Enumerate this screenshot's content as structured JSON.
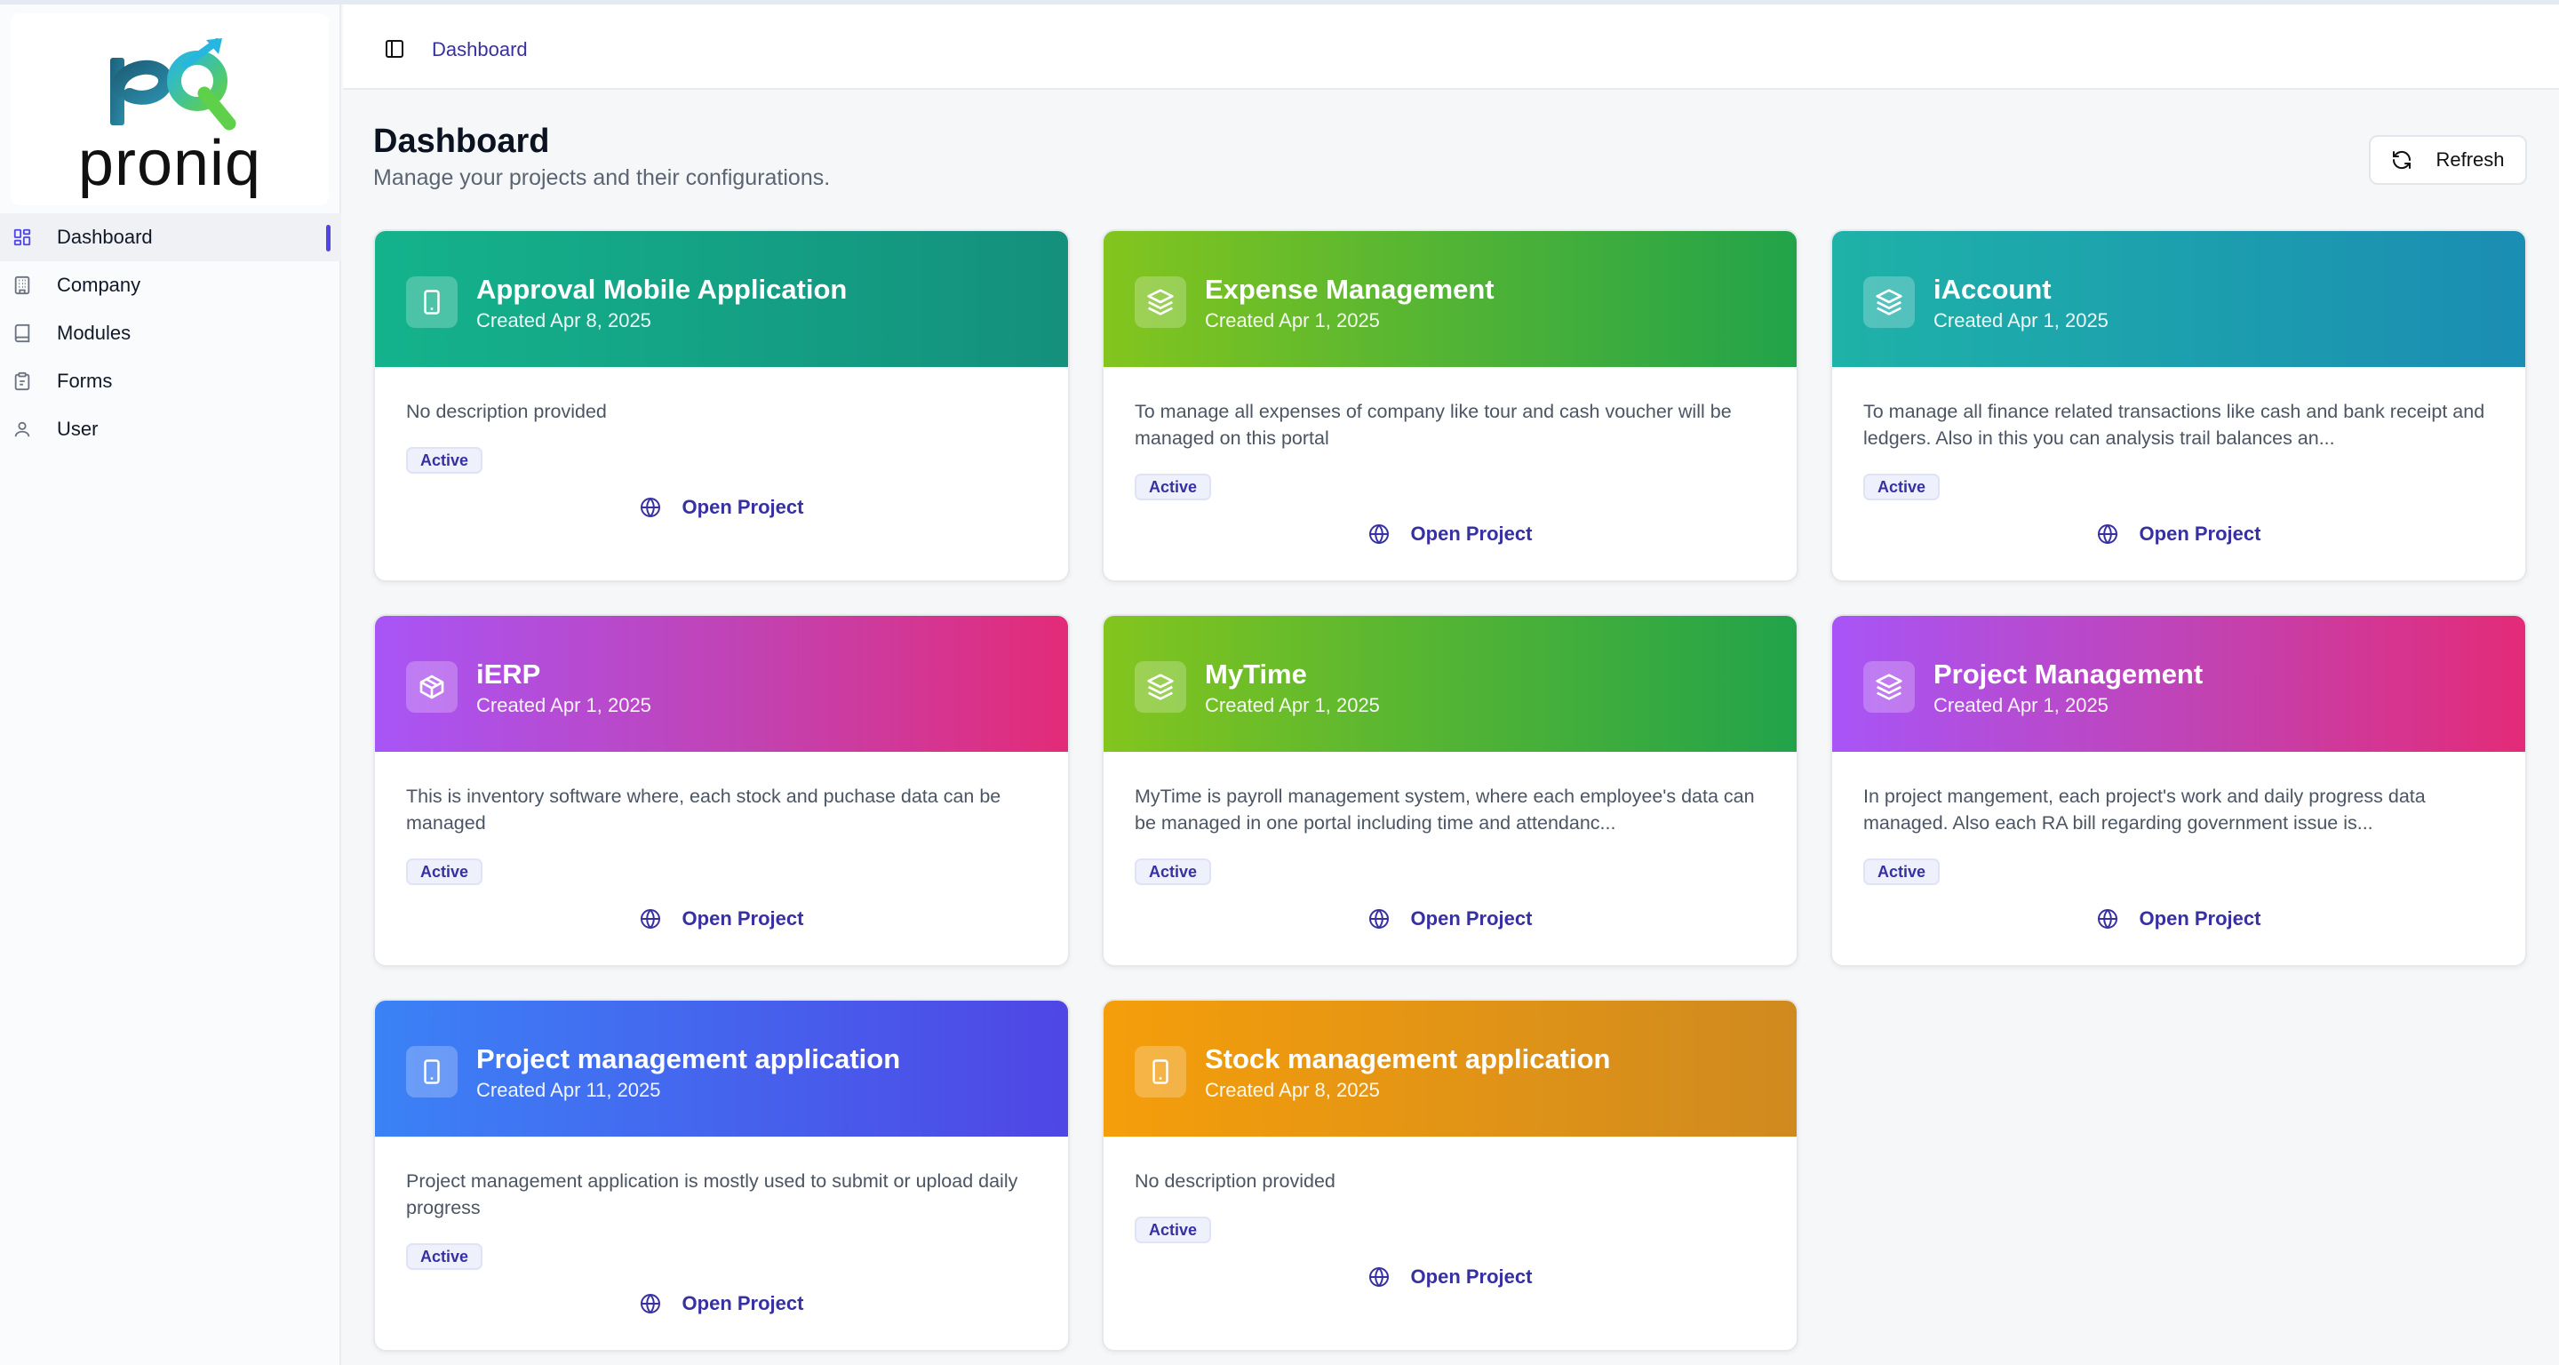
{
  "brand": {
    "name": "proniq"
  },
  "sidebar": {
    "items": [
      {
        "label": "Dashboard",
        "icon": "grid-icon",
        "active": true
      },
      {
        "label": "Company",
        "icon": "building-icon"
      },
      {
        "label": "Modules",
        "icon": "book-icon"
      },
      {
        "label": "Forms",
        "icon": "clipboard-icon"
      },
      {
        "label": "User",
        "icon": "user-icon"
      }
    ]
  },
  "header": {
    "breadcrumb": "Dashboard"
  },
  "page": {
    "title": "Dashboard",
    "subtitle": "Manage your projects and their configurations.",
    "refresh_label": "Refresh"
  },
  "projects": [
    {
      "title": "Approval Mobile Application",
      "created": "Created Apr 8, 2025",
      "description": "No description provided",
      "status": "Active",
      "action": "Open Project",
      "icon": "smartphone-icon",
      "gradient": "teal"
    },
    {
      "title": "Expense Management",
      "created": "Created Apr 1, 2025",
      "description": "To manage all expenses of company like tour and cash voucher will be managed on this portal",
      "status": "Active",
      "action": "Open Project",
      "icon": "layers-icon",
      "gradient": "green"
    },
    {
      "title": "iAccount",
      "created": "Created Apr 1, 2025",
      "description": "To manage all finance related transactions like cash and bank receipt and ledgers. Also in this you can analysis trail balances an...",
      "status": "Active",
      "action": "Open Project",
      "icon": "layers-icon",
      "gradient": "cyan"
    },
    {
      "title": "iERP",
      "created": "Created Apr 1, 2025",
      "description": "This is inventory software where, each stock and puchase data can be managed",
      "status": "Active",
      "action": "Open Project",
      "icon": "package-icon",
      "gradient": "purple"
    },
    {
      "title": "MyTime",
      "created": "Created Apr 1, 2025",
      "description": "MyTime is payroll management system, where each employee's data can be managed in one portal including time and attendanc...",
      "status": "Active",
      "action": "Open Project",
      "icon": "layers-icon",
      "gradient": "green"
    },
    {
      "title": "Project Management",
      "created": "Created Apr 1, 2025",
      "description": "In project mangement, each project's work and daily progress data managed. Also each RA bill regarding government issue is...",
      "status": "Active",
      "action": "Open Project",
      "icon": "layers-icon",
      "gradient": "purple"
    },
    {
      "title": "Project management application",
      "created": "Created Apr 11, 2025",
      "description": "Project management application is mostly used to submit or upload daily progress",
      "status": "Active",
      "action": "Open Project",
      "icon": "smartphone-icon",
      "gradient": "blue"
    },
    {
      "title": "Stock management application",
      "created": "Created Apr 8, 2025",
      "description": "No description provided",
      "status": "Active",
      "action": "Open Project",
      "icon": "smartphone-icon",
      "gradient": "amber"
    }
  ]
}
